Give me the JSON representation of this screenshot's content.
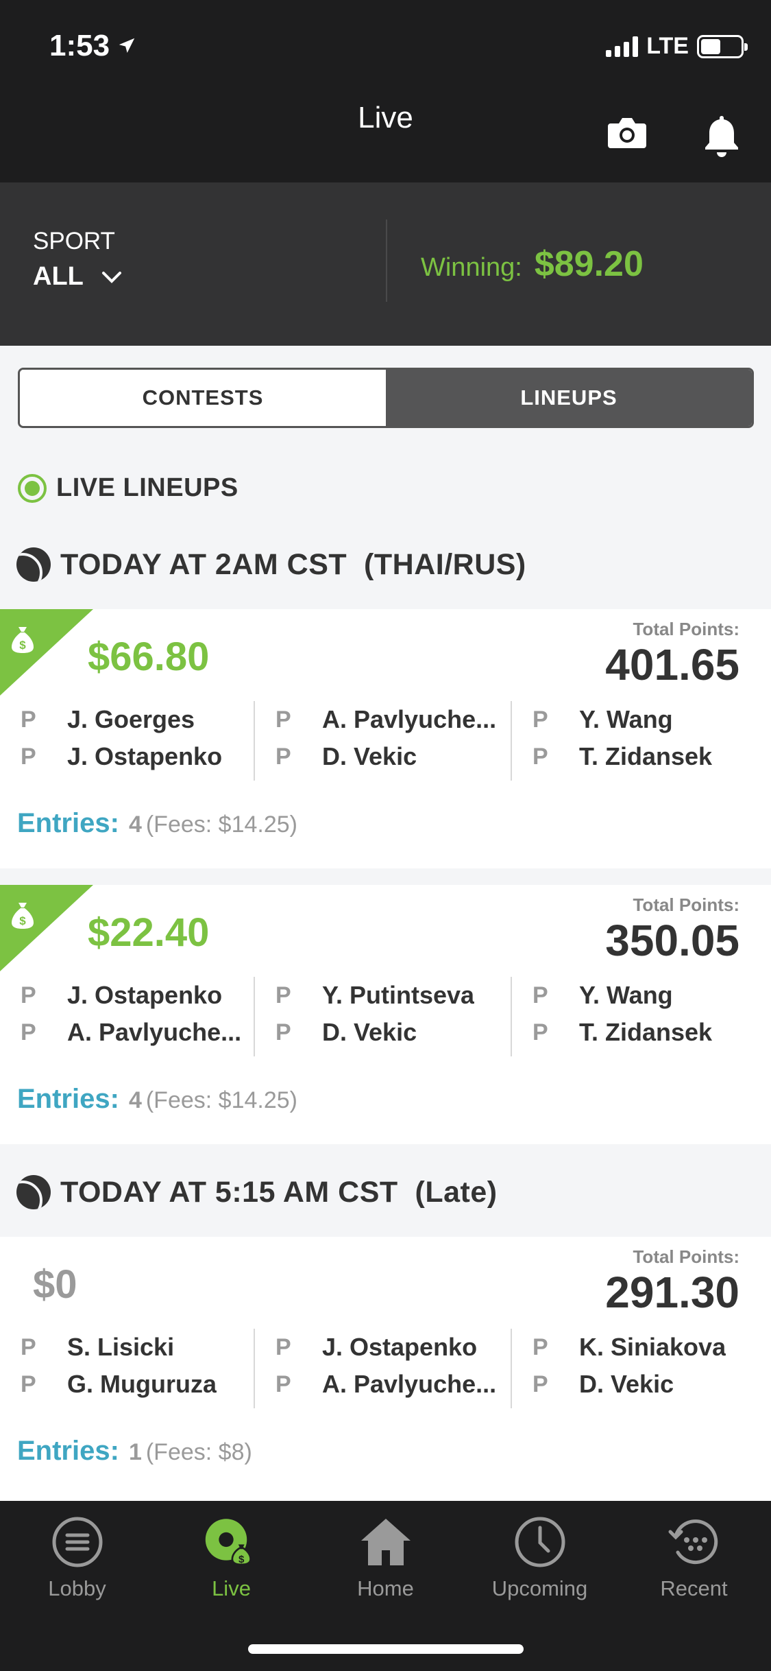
{
  "status_bar": {
    "time": "1:53",
    "network": "LTE",
    "battery_level": 0.4
  },
  "header": {
    "title": "Live"
  },
  "filter": {
    "sport_label": "SPORT",
    "sport_value": "ALL",
    "winning_label": "Winning:",
    "winning_value": "$89.20"
  },
  "segments": {
    "contests": "CONTESTS",
    "lineups": "LINEUPS",
    "active": "LINEUPS"
  },
  "live_lineups_label": "LIVE LINEUPS",
  "sections": [
    {
      "title": "TODAY AT 2AM CST  (THAI/RUS)",
      "cards": [
        {
          "amount": "$66.80",
          "won": true,
          "total_points_label": "Total Points:",
          "total_points": "401.65",
          "players": [
            [
              {
                "pos": "P",
                "name": "J. Goerges"
              },
              {
                "pos": "P",
                "name": "J. Ostapenko"
              }
            ],
            [
              {
                "pos": "P",
                "name": "A. Pavlyuche..."
              },
              {
                "pos": "P",
                "name": "D. Vekic"
              }
            ],
            [
              {
                "pos": "P",
                "name": "Y. Wang"
              },
              {
                "pos": "P",
                "name": "T. Zidansek"
              }
            ]
          ],
          "entries_label": "Entries:",
          "entries_count": "4",
          "fees": "(Fees: $14.25)"
        },
        {
          "amount": "$22.40",
          "won": true,
          "total_points_label": "Total Points:",
          "total_points": "350.05",
          "players": [
            [
              {
                "pos": "P",
                "name": "J. Ostapenko"
              },
              {
                "pos": "P",
                "name": "A. Pavlyuche..."
              }
            ],
            [
              {
                "pos": "P",
                "name": "Y. Putintseva"
              },
              {
                "pos": "P",
                "name": "D. Vekic"
              }
            ],
            [
              {
                "pos": "P",
                "name": "Y. Wang"
              },
              {
                "pos": "P",
                "name": "T. Zidansek"
              }
            ]
          ],
          "entries_label": "Entries:",
          "entries_count": "4",
          "fees": "(Fees: $14.25)"
        }
      ]
    },
    {
      "title": "TODAY AT 5:15 AM CST  (Late)",
      "cards": [
        {
          "amount": "$0",
          "won": false,
          "total_points_label": "Total Points:",
          "total_points": "291.30",
          "players": [
            [
              {
                "pos": "P",
                "name": "S. Lisicki"
              },
              {
                "pos": "P",
                "name": "G. Muguruza"
              }
            ],
            [
              {
                "pos": "P",
                "name": "J. Ostapenko"
              },
              {
                "pos": "P",
                "name": "A. Pavlyuche..."
              }
            ],
            [
              {
                "pos": "P",
                "name": "K. Siniakova"
              },
              {
                "pos": "P",
                "name": "D. Vekic"
              }
            ]
          ],
          "entries_label": "Entries:",
          "entries_count": "1",
          "fees": "(Fees: $8)"
        }
      ]
    }
  ],
  "tabs": [
    {
      "label": "Lobby",
      "icon": "menu-circle-icon",
      "active": false
    },
    {
      "label": "Live",
      "icon": "live-money-icon",
      "active": true
    },
    {
      "label": "Home",
      "icon": "home-icon",
      "active": false
    },
    {
      "label": "Upcoming",
      "icon": "clock-icon",
      "active": false
    },
    {
      "label": "Recent",
      "icon": "history-icon",
      "active": false
    }
  ],
  "colors": {
    "accent_green": "#7cc242",
    "entries_blue": "#3fa6c2",
    "header_bg": "#1d1d1e",
    "filter_bg": "#333334"
  }
}
